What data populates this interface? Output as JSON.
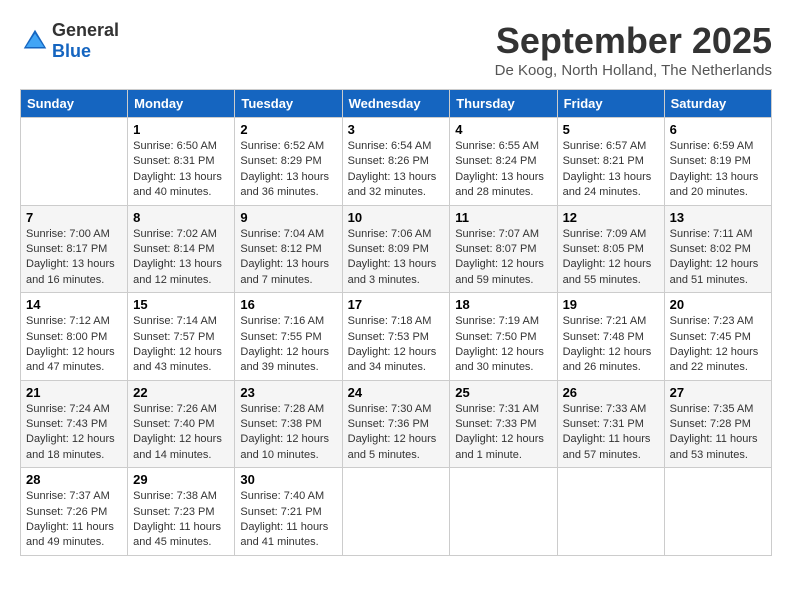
{
  "header": {
    "logo": {
      "general": "General",
      "blue": "Blue"
    },
    "title": "September 2025",
    "subtitle": "De Koog, North Holland, The Netherlands"
  },
  "weekdays": [
    "Sunday",
    "Monday",
    "Tuesday",
    "Wednesday",
    "Thursday",
    "Friday",
    "Saturday"
  ],
  "weeks": [
    [
      {
        "day": "",
        "info": ""
      },
      {
        "day": "1",
        "info": "Sunrise: 6:50 AM\nSunset: 8:31 PM\nDaylight: 13 hours\nand 40 minutes."
      },
      {
        "day": "2",
        "info": "Sunrise: 6:52 AM\nSunset: 8:29 PM\nDaylight: 13 hours\nand 36 minutes."
      },
      {
        "day": "3",
        "info": "Sunrise: 6:54 AM\nSunset: 8:26 PM\nDaylight: 13 hours\nand 32 minutes."
      },
      {
        "day": "4",
        "info": "Sunrise: 6:55 AM\nSunset: 8:24 PM\nDaylight: 13 hours\nand 28 minutes."
      },
      {
        "day": "5",
        "info": "Sunrise: 6:57 AM\nSunset: 8:21 PM\nDaylight: 13 hours\nand 24 minutes."
      },
      {
        "day": "6",
        "info": "Sunrise: 6:59 AM\nSunset: 8:19 PM\nDaylight: 13 hours\nand 20 minutes."
      }
    ],
    [
      {
        "day": "7",
        "info": "Sunrise: 7:00 AM\nSunset: 8:17 PM\nDaylight: 13 hours\nand 16 minutes."
      },
      {
        "day": "8",
        "info": "Sunrise: 7:02 AM\nSunset: 8:14 PM\nDaylight: 13 hours\nand 12 minutes."
      },
      {
        "day": "9",
        "info": "Sunrise: 7:04 AM\nSunset: 8:12 PM\nDaylight: 13 hours\nand 7 minutes."
      },
      {
        "day": "10",
        "info": "Sunrise: 7:06 AM\nSunset: 8:09 PM\nDaylight: 13 hours\nand 3 minutes."
      },
      {
        "day": "11",
        "info": "Sunrise: 7:07 AM\nSunset: 8:07 PM\nDaylight: 12 hours\nand 59 minutes."
      },
      {
        "day": "12",
        "info": "Sunrise: 7:09 AM\nSunset: 8:05 PM\nDaylight: 12 hours\nand 55 minutes."
      },
      {
        "day": "13",
        "info": "Sunrise: 7:11 AM\nSunset: 8:02 PM\nDaylight: 12 hours\nand 51 minutes."
      }
    ],
    [
      {
        "day": "14",
        "info": "Sunrise: 7:12 AM\nSunset: 8:00 PM\nDaylight: 12 hours\nand 47 minutes."
      },
      {
        "day": "15",
        "info": "Sunrise: 7:14 AM\nSunset: 7:57 PM\nDaylight: 12 hours\nand 43 minutes."
      },
      {
        "day": "16",
        "info": "Sunrise: 7:16 AM\nSunset: 7:55 PM\nDaylight: 12 hours\nand 39 minutes."
      },
      {
        "day": "17",
        "info": "Sunrise: 7:18 AM\nSunset: 7:53 PM\nDaylight: 12 hours\nand 34 minutes."
      },
      {
        "day": "18",
        "info": "Sunrise: 7:19 AM\nSunset: 7:50 PM\nDaylight: 12 hours\nand 30 minutes."
      },
      {
        "day": "19",
        "info": "Sunrise: 7:21 AM\nSunset: 7:48 PM\nDaylight: 12 hours\nand 26 minutes."
      },
      {
        "day": "20",
        "info": "Sunrise: 7:23 AM\nSunset: 7:45 PM\nDaylight: 12 hours\nand 22 minutes."
      }
    ],
    [
      {
        "day": "21",
        "info": "Sunrise: 7:24 AM\nSunset: 7:43 PM\nDaylight: 12 hours\nand 18 minutes."
      },
      {
        "day": "22",
        "info": "Sunrise: 7:26 AM\nSunset: 7:40 PM\nDaylight: 12 hours\nand 14 minutes."
      },
      {
        "day": "23",
        "info": "Sunrise: 7:28 AM\nSunset: 7:38 PM\nDaylight: 12 hours\nand 10 minutes."
      },
      {
        "day": "24",
        "info": "Sunrise: 7:30 AM\nSunset: 7:36 PM\nDaylight: 12 hours\nand 5 minutes."
      },
      {
        "day": "25",
        "info": "Sunrise: 7:31 AM\nSunset: 7:33 PM\nDaylight: 12 hours\nand 1 minute."
      },
      {
        "day": "26",
        "info": "Sunrise: 7:33 AM\nSunset: 7:31 PM\nDaylight: 11 hours\nand 57 minutes."
      },
      {
        "day": "27",
        "info": "Sunrise: 7:35 AM\nSunset: 7:28 PM\nDaylight: 11 hours\nand 53 minutes."
      }
    ],
    [
      {
        "day": "28",
        "info": "Sunrise: 7:37 AM\nSunset: 7:26 PM\nDaylight: 11 hours\nand 49 minutes."
      },
      {
        "day": "29",
        "info": "Sunrise: 7:38 AM\nSunset: 7:23 PM\nDaylight: 11 hours\nand 45 minutes."
      },
      {
        "day": "30",
        "info": "Sunrise: 7:40 AM\nSunset: 7:21 PM\nDaylight: 11 hours\nand 41 minutes."
      },
      {
        "day": "",
        "info": ""
      },
      {
        "day": "",
        "info": ""
      },
      {
        "day": "",
        "info": ""
      },
      {
        "day": "",
        "info": ""
      }
    ]
  ]
}
